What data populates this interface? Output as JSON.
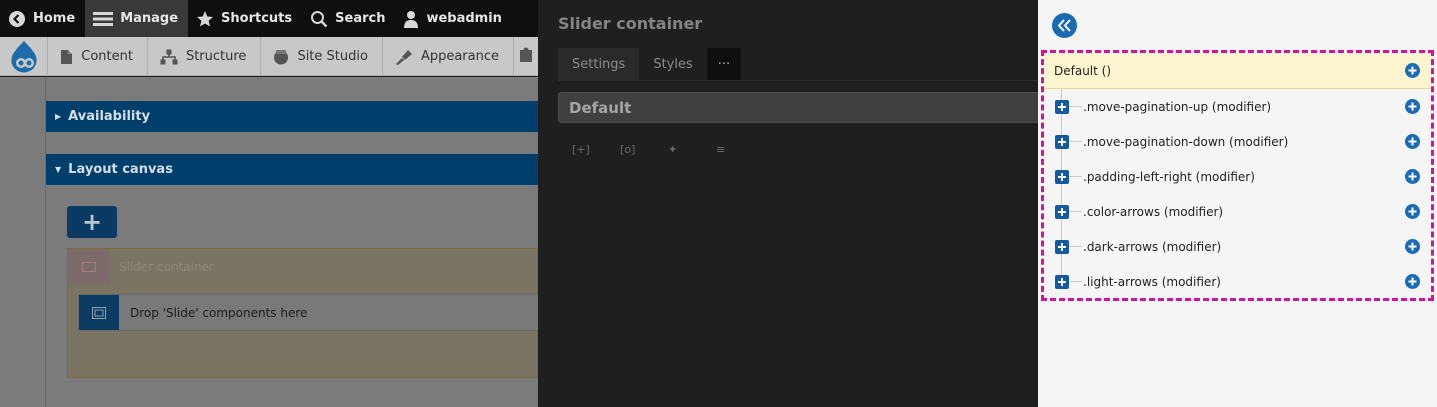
{
  "toolbar": {
    "items": [
      {
        "label": "Home",
        "icon": "chevron-left-circle-icon"
      },
      {
        "label": "Manage",
        "icon": "menu-icon",
        "active": true
      },
      {
        "label": "Shortcuts",
        "icon": "star-icon"
      },
      {
        "label": "Search",
        "icon": "search-icon"
      },
      {
        "label": "webadmin",
        "icon": "user-icon"
      }
    ]
  },
  "tray": {
    "logo_icon": "drupal-drop-icon",
    "items": [
      {
        "label": "Content",
        "icon": "document-icon"
      },
      {
        "label": "Structure",
        "icon": "sitemap-icon"
      },
      {
        "label": "Site Studio",
        "icon": "site-studio-icon"
      },
      {
        "label": "Appearance",
        "icon": "paintbrush-icon"
      }
    ]
  },
  "left": {
    "availability_label": "Availability",
    "layout_canvas_label": "Layout canvas",
    "add_button_label": "+",
    "slider_container_label": "Slider container",
    "drop_zone_label": "Drop 'Slide' components here"
  },
  "mid": {
    "title": "Slider container",
    "tabs": {
      "settings": "Settings",
      "styles": "Styles",
      "more": "···"
    },
    "style_input_value": "Default",
    "icon_labels": [
      "[+]",
      "[o]",
      "✦",
      "≡"
    ]
  },
  "right": {
    "default_label": "Default ()",
    "modifiers": [
      ".move-pagination-up (modifier)",
      ".move-pagination-down (modifier)",
      ".padding-left-right (modifier)",
      ".color-arrows (modifier)",
      ".dark-arrows (modifier)",
      ".light-arrows (modifier)"
    ]
  },
  "colors": {
    "accent_blue": "#1b6bb4",
    "highlight_magenta": "#d6119f",
    "default_row_bg": "#fdf5cf"
  }
}
